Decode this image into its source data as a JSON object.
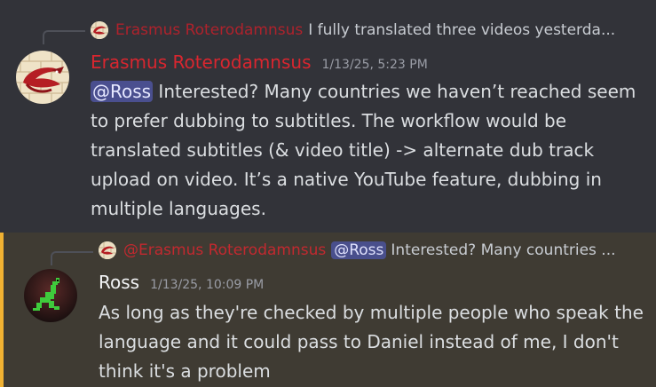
{
  "messages": [
    {
      "reply": {
        "author": "Erasmus Roterodamnsus",
        "mention": "",
        "text": "I fully translated three videos yesterda..."
      },
      "author": "Erasmus Roterodamnsus",
      "author_color": "#d9262f",
      "timestamp": "1/13/25, 5:23 PM",
      "mention": "@Ross",
      "text": " Interested? Many countries we haven’t reached seem to prefer dubbing to subtitles. The workflow would be translated subtitles (& video title) -> alternate dub track upload on video. It’s a native YouTube feature, dubbing in multiple languages."
    },
    {
      "reply": {
        "author": "@Erasmus Roterodamnsus",
        "mention": "@Ross",
        "text": "Interested? Many countries ..."
      },
      "author": "Ross",
      "author_color": "#f2f3f5",
      "timestamp": "1/13/25, 10:09 PM",
      "mention": "",
      "text": "As long as they're checked by multiple people who speak the language and it could pass to Daniel instead of me, I don't think it's a problem"
    }
  ],
  "colors": {
    "background": "#323339",
    "mention_background": "#4a4f8f",
    "highlight_background": "#3f3b33",
    "highlight_bar": "#f0b132"
  },
  "icons": {
    "erasmus_avatar": "red-dragon-on-brick-wall-avatar",
    "ross_avatar": "green-frog-pixel-avatar"
  }
}
